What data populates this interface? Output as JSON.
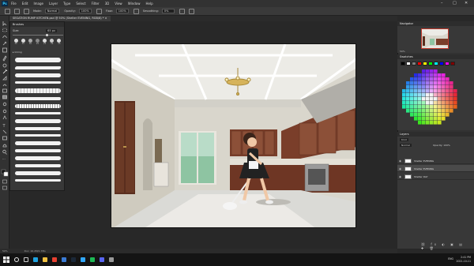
{
  "app": {
    "logo": "Ps"
  },
  "menubar": {
    "items": [
      "File",
      "Edit",
      "Image",
      "Layer",
      "Type",
      "Select",
      "Filter",
      "3D",
      "View",
      "Window",
      "Help"
    ]
  },
  "window_controls": {
    "minimize": "–",
    "maximize": "□",
    "close": "✕"
  },
  "options": {
    "mode_label": "Mode:",
    "mode_value": "Normal",
    "opacity_label": "Opacity:",
    "opacity_value": "100%",
    "flow_label": "Flow:",
    "flow_value": "100%",
    "smoothing_label": "Smoothing:",
    "smoothing_value": "0%"
  },
  "document_tab": {
    "label": "SEGATION RUMP KITCHEN.psd @ 50% (Shelter EVENING, RGB/8) * ×"
  },
  "brushes_panel": {
    "title": "Brushes",
    "size_label": "Size:",
    "size_value": "65 px",
    "preset_sizes": [
      "30",
      "30",
      "30",
      "25",
      "25",
      "36",
      "25"
    ],
    "group_name": "▸ Inking"
  },
  "navigator": {
    "title": "Navigator",
    "zoom": "50%"
  },
  "swatches": {
    "title": "Swatches",
    "colors": [
      "#000000",
      "#ffffff",
      "#808080",
      "#ff0000",
      "#ffff00",
      "#00ff00",
      "#00ffff",
      "#0000ff",
      "#ff00ff",
      "#7f0000"
    ]
  },
  "layers": {
    "title": "Layers",
    "kind_label": "Kind",
    "blend": "Normal",
    "opacity": "Opacity: 100%",
    "items": [
      {
        "name": "Shelter EVENING",
        "selected": false
      },
      {
        "name": "Shelter EVENING",
        "selected": true
      },
      {
        "name": "Shelter DAY",
        "selected": false
      }
    ]
  },
  "status": {
    "zoom": "50%",
    "doc": "Doc: 16.2M/1.78G"
  },
  "taskbar": {
    "lang": "ENG",
    "time": "2:41 PM",
    "date": "2021-10-11",
    "icons": [
      "search-icon",
      "task-view-icon",
      "edge-icon",
      "explorer-icon",
      "chrome-icon",
      "mail-icon",
      "steam-icon",
      "photoshop-icon",
      "spotify-icon",
      "discord-icon",
      "settings-icon"
    ],
    "icon_colors": [
      "#eeeeee",
      "#cccccc",
      "#1fa3e0",
      "#f0c040",
      "#e84030",
      "#3a7bd5",
      "#1b2838",
      "#31a8ff",
      "#1db954",
      "#5865f2",
      "#999999"
    ]
  }
}
